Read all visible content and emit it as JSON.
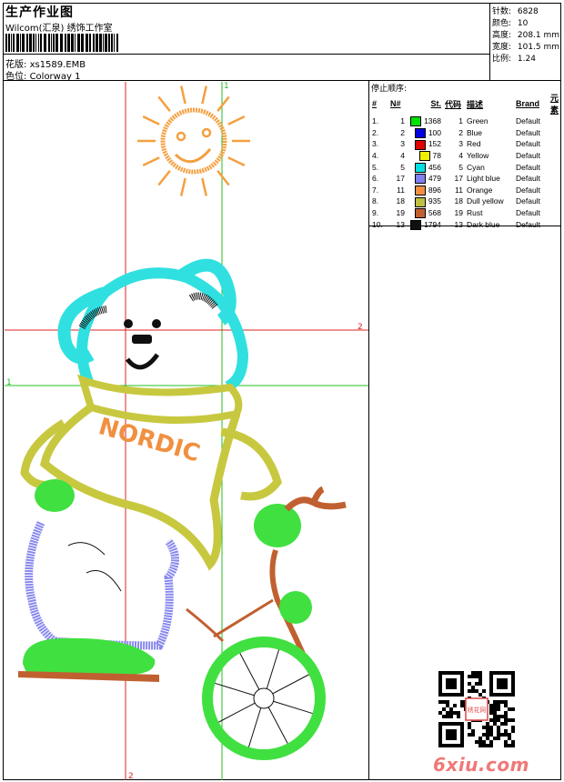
{
  "header": {
    "title": "生产作业图",
    "company": "Wilcom(汇泉) 绣饰工作室",
    "pattern_label": "花版:",
    "pattern_name": "xs1589.EMB",
    "colorway_label": "色位:",
    "colorway_name": "Colorway 1"
  },
  "stats": [
    {
      "label": "针数:",
      "value": "6828"
    },
    {
      "label": "颜色:",
      "value": "10"
    },
    {
      "label": "高度:",
      "value": "208.1 mm"
    },
    {
      "label": "宽度:",
      "value": "101.5 mm"
    },
    {
      "label": "比例:",
      "value": "1.24"
    }
  ],
  "stop_sequence": {
    "title": "停止顺序:",
    "columns": [
      "#",
      "N#",
      "St.",
      "代码",
      "描述",
      "Brand",
      "元素"
    ],
    "rows": [
      {
        "idx": "1.",
        "n": "1",
        "color": "#00e000",
        "st": "1368",
        "code": "1",
        "desc": "Green",
        "brand": "Default"
      },
      {
        "idx": "2.",
        "n": "2",
        "color": "#0000e0",
        "st": "100",
        "code": "2",
        "desc": "Blue",
        "brand": "Default"
      },
      {
        "idx": "3.",
        "n": "3",
        "color": "#e00000",
        "st": "152",
        "code": "3",
        "desc": "Red",
        "brand": "Default"
      },
      {
        "idx": "4.",
        "n": "4",
        "color": "#f0f000",
        "st": "78",
        "code": "4",
        "desc": "Yellow",
        "brand": "Default"
      },
      {
        "idx": "5.",
        "n": "5",
        "color": "#00e0e0",
        "st": "456",
        "code": "5",
        "desc": "Cyan",
        "brand": "Default"
      },
      {
        "idx": "6.",
        "n": "17",
        "color": "#8080f0",
        "st": "479",
        "code": "17",
        "desc": "Light blue",
        "brand": "Default"
      },
      {
        "idx": "7.",
        "n": "11",
        "color": "#f09040",
        "st": "896",
        "code": "11",
        "desc": "Orange",
        "brand": "Default"
      },
      {
        "idx": "8.",
        "n": "18",
        "color": "#c0c040",
        "st": "935",
        "code": "18",
        "desc": "Dull yellow",
        "brand": "Default"
      },
      {
        "idx": "9.",
        "n": "19",
        "color": "#c06030",
        "st": "568",
        "code": "19",
        "desc": "Rust",
        "brand": "Default"
      },
      {
        "idx": "10.",
        "n": "13",
        "color": "#101010",
        "st": "1794",
        "code": "13",
        "desc": "Dark blue",
        "brand": "Default"
      }
    ]
  },
  "design": {
    "text": "NORDIC",
    "axis_labels": [
      "1",
      "2",
      "1",
      "2"
    ]
  },
  "watermark": "6xiu.com",
  "qr_text": "绣花网"
}
